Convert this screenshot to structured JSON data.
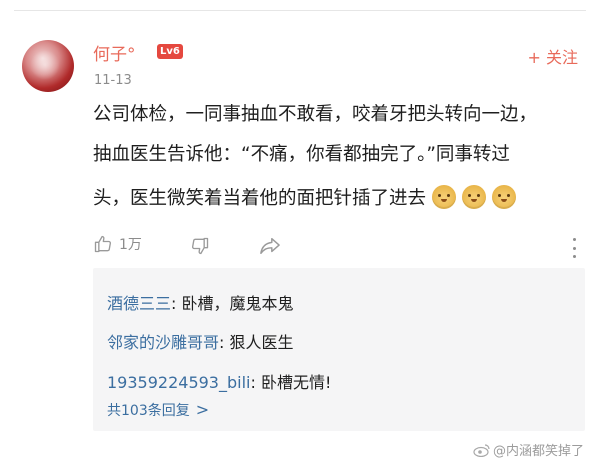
{
  "comment": {
    "username": "何子°",
    "level_badge": "Lv6",
    "date": "11-13",
    "follow_label": "+ 关注",
    "text_lines": [
      "公司体检，一同事抽血不敢看，咬着牙把头转向一边，",
      "抽血医生告诉他：“不痛，你看都抽完了。”同事转过",
      "头，医生微笑着当着他的面把针插了进去"
    ],
    "emojis": [
      "doge-emoji",
      "doge-emoji",
      "doge-emoji"
    ],
    "like_count": "1万"
  },
  "replies": {
    "items": [
      {
        "name": "酒德三三",
        "text": ": 卧槽，魔鬼本鬼"
      },
      {
        "name": "邻家的沙雕哥哥",
        "text": ": 狠人医生"
      },
      {
        "name": "19359224593_bili",
        "text": ": 卧槽无情!"
      }
    ],
    "more_label": "共103条回复",
    "more_chevron": ">"
  },
  "watermark": {
    "text": "@内涵都笑掉了"
  },
  "colors": {
    "username": "#e86a5a",
    "follow": "#e86a5a",
    "reply_name": "#3b6ea0",
    "reply_bg": "#f5f5f6",
    "muted": "#8c8c8c"
  }
}
